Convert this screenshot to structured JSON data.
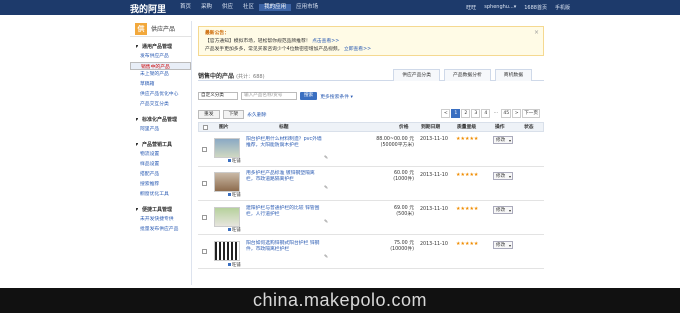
{
  "topbar": {
    "logo": "我的阿里",
    "nav": [
      "首页",
      "采购",
      "供应",
      "社区",
      "我的应用",
      "应用市场"
    ],
    "active_index": 4,
    "right": [
      "旺旺",
      "sphenghu...▾",
      "1688首页",
      "手机版"
    ]
  },
  "sidebar": {
    "title": "供应产品",
    "badge": "供",
    "sections": [
      {
        "title": "通用产品管理",
        "items": [
          "发布供应产品",
          "销售中的产品",
          "未上架的产品",
          "草稿箱",
          "供应产品优化中心",
          "产品交互分类"
        ],
        "selected": 1
      },
      {
        "title": "标准化产品管理",
        "items": [
          "阿里产品"
        ],
        "selected": -1
      },
      {
        "title": "产品营销工具",
        "items": [
          "物流设置",
          "样品设置",
          "搭配产品",
          "搜索推荐",
          "橱窗优化工具"
        ],
        "selected": -1
      },
      {
        "title": "便捷工具管理",
        "items": [
          "未开发快捷专供",
          "批量发布供应产品"
        ],
        "selected": -1
      }
    ]
  },
  "notice": {
    "heading": "最新公告：",
    "line1": "【官方通知】模拟市场，轻松帮你规范品牌推荐！",
    "link1": "点击查看>>",
    "line2": "产品发手更加多多，常见买家咨询少个4位数密密增加产品视频。",
    "link2": "立即查看>>",
    "close": "×"
  },
  "list": {
    "title": "销售中的产品",
    "count": "(共计：688)",
    "tabs": [
      "供应产品分类",
      "产品数据分析",
      "商机数据"
    ]
  },
  "filter": {
    "category": "自定义分类",
    "keyword_placeholder": "输入产品名称/货号",
    "search": "搜索",
    "advanced": "更多搜索条件 ▾"
  },
  "actions": {
    "refresh": "重发",
    "offline": "下架",
    "delete": "永久删除",
    "pager": [
      "<",
      "1",
      "2",
      "3",
      "4",
      "...",
      "45",
      ">",
      "下一页"
    ],
    "current_page": "1"
  },
  "columns": [
    "图片",
    "标题",
    "价格",
    "到期日期",
    "质量星级",
    "操作",
    "状态"
  ],
  "rows": [
    {
      "title": "阳台护栏用什么材料制造？pvc外墙推荐，大阳能防腐木护栏",
      "price": "88.00~00.00 元",
      "qty": "(50000平方米)",
      "date": "2013-11-10",
      "stars": "★★★★★",
      "action": "修改",
      "shop": "旺铺"
    },
    {
      "title": "用多护栏产品标准 镀锌钢塑隔离栏，市政道路隔离护栏",
      "price": "60.00 元",
      "qty": "(1000件)",
      "date": "2013-11-10",
      "stars": "★★★★★",
      "action": "修改",
      "shop": "旺铺"
    },
    {
      "title": "建阳护栏与普通护栏的比较 锌管围栏，人行道护栏",
      "price": "69.00 元",
      "qty": "(500米)",
      "date": "2013-11-10",
      "stars": "★★★★★",
      "action": "修改",
      "shop": "旺铺"
    },
    {
      "title": "阳台如何选购锌钢式阳台护栏 锌钢件，市政隔离栏护栏",
      "price": "75.00 元",
      "qty": "(10000件)",
      "date": "2013-11-10",
      "stars": "★★★★★",
      "action": "修改",
      "shop": "旺铺"
    }
  ],
  "footer": {
    "watermark": "china.makepolo.com"
  }
}
